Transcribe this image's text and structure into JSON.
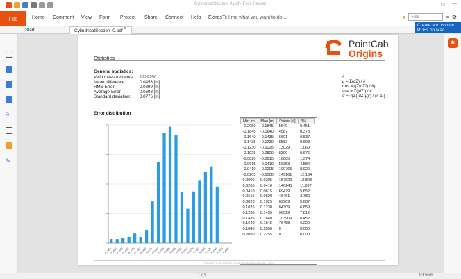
{
  "app": {
    "title": "CylindricalSection_0.pdf - Foxit Reader",
    "file_tab": "File",
    "tabs": [
      "Home",
      "Comment",
      "View",
      "Form",
      "Protect",
      "Share",
      "Connect",
      "Help",
      "Extras"
    ],
    "tell_me": "Tell me what you want to do...",
    "find_placeholder": "Find",
    "promo": "Create and convert PDFs on Mac"
  },
  "doc_tabs": [
    "Start",
    "CylindricalSection_0.pdf"
  ],
  "report": {
    "title": "Statistics",
    "logo_line1": "PointCab",
    "logo_line2": "Origins",
    "general_title": "General statistics:",
    "stats": [
      {
        "label": "Valid measurements:",
        "value": "1229250"
      },
      {
        "label": "Mean difference:",
        "value": "0.0453 [m]"
      },
      {
        "label": "RMS-Error:",
        "value": "0.0899 [m]"
      },
      {
        "label": "Average-Error:",
        "value": "0.0698 [m]"
      },
      {
        "label": "Standard deviation:",
        "value": "0.0776 [m]"
      }
    ],
    "formulas": [
      "#",
      "μ = Σ(dZ) / #",
      "rms =√(Σ(dZ²) / #)",
      "ave = Σ(|dZ|) / #",
      "σ = √(Σ((dZ-μ)²) / (#-1))"
    ],
    "dist_title": "Error distribution",
    "footer": "Created by PointCab (www.pointcab-software.com)",
    "table": {
      "headers": [
        "Min [m]",
        "Max [m]",
        "Points [#]",
        "[%]"
      ],
      "rows": [
        [
          "-0.2050",
          "-0.1845",
          "5549",
          "0.451"
        ],
        [
          "-0.1845",
          "-0.1640",
          "4587",
          "0.373"
        ],
        [
          "-0.1640",
          "-0.1435",
          "6601",
          "0.537"
        ],
        [
          "-0.1435",
          "-0.1230",
          "8583",
          "0.698"
        ],
        [
          "-0.1230",
          "-0.1025",
          "13029",
          "1.060"
        ],
        [
          "-0.1025",
          "-0.0820",
          "8309",
          "0.676"
        ],
        [
          "-0.0820",
          "-0.0615",
          "16885",
          "1.374"
        ],
        [
          "-0.0615",
          "-0.0410",
          "56353",
          "4.584"
        ],
        [
          "-0.0410",
          "-0.0205",
          "109765",
          "8.929"
        ],
        [
          "-0.0205",
          "-0.0000",
          "149161",
          "12.134"
        ],
        [
          "0.0000",
          "0.0205",
          "157629",
          "12.823"
        ],
        [
          "0.0205",
          "0.0410",
          "146245",
          "11.897"
        ],
        [
          "0.0410",
          "0.0615",
          "69479",
          "5.652"
        ],
        [
          "0.0615",
          "0.0820",
          "46461",
          "3.780"
        ],
        [
          "0.0820",
          "0.1025",
          "69909",
          "5.687"
        ],
        [
          "0.1025",
          "0.1230",
          "84309",
          "6.859"
        ],
        [
          "0.1230",
          "0.1435",
          "96029",
          "7.812"
        ],
        [
          "0.1435",
          "0.1640",
          "103909",
          "8.452"
        ],
        [
          "0.1640",
          "0.1845",
          "76458",
          "6.220"
        ],
        [
          "0.1845",
          "0.2050",
          "0",
          "0.000"
        ],
        [
          "0.2050",
          "0.2255",
          "0",
          "0.000"
        ]
      ]
    }
  },
  "chart_data": {
    "type": "bar",
    "categories": [
      "-0.2050",
      "-0.1845",
      "-0.1640",
      "-0.1435",
      "-0.1230",
      "-0.1025",
      "-0.0820",
      "-0.0615",
      "-0.0410",
      "-0.0205",
      "0.0000",
      "0.0205",
      "0.0410",
      "0.0615",
      "0.0820",
      "0.1025",
      "0.1230",
      "0.1435",
      "0.1640",
      "0.1845",
      "0.2050"
    ],
    "values": [
      5549,
      4587,
      6601,
      8583,
      13029,
      8309,
      16885,
      56353,
      109765,
      149161,
      157629,
      146245,
      69479,
      46461,
      69909,
      84309,
      96029,
      103909,
      76458,
      0,
      0
    ],
    "ylim": [
      0,
      160000
    ],
    "color": "#2b9ce0",
    "grid": true
  },
  "status": {
    "page": "1 / 1",
    "zoom": "93.56%"
  }
}
